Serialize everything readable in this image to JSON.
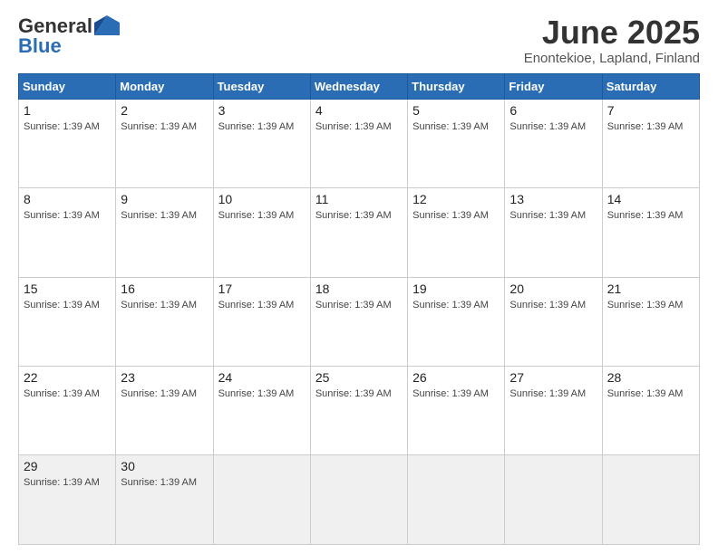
{
  "logo": {
    "general": "General",
    "blue": "Blue"
  },
  "header": {
    "month": "June 2025",
    "location": "Enontekioe, Lapland, Finland"
  },
  "days_of_week": [
    "Sunday",
    "Monday",
    "Tuesday",
    "Wednesday",
    "Thursday",
    "Friday",
    "Saturday"
  ],
  "sunrise_text": "Sunrise: 1:39 AM",
  "weeks": [
    [
      {
        "day": "1",
        "sunrise": "Sunrise: 1:39 AM"
      },
      {
        "day": "2",
        "sunrise": "Sunrise: 1:39 AM"
      },
      {
        "day": "3",
        "sunrise": "Sunrise: 1:39 AM"
      },
      {
        "day": "4",
        "sunrise": "Sunrise: 1:39 AM"
      },
      {
        "day": "5",
        "sunrise": "Sunrise: 1:39 AM"
      },
      {
        "day": "6",
        "sunrise": "Sunrise: 1:39 AM"
      },
      {
        "day": "7",
        "sunrise": "Sunrise: 1:39 AM"
      }
    ],
    [
      {
        "day": "8",
        "sunrise": "Sunrise: 1:39 AM"
      },
      {
        "day": "9",
        "sunrise": "Sunrise: 1:39 AM"
      },
      {
        "day": "10",
        "sunrise": "Sunrise: 1:39 AM"
      },
      {
        "day": "11",
        "sunrise": "Sunrise: 1:39 AM"
      },
      {
        "day": "12",
        "sunrise": "Sunrise: 1:39 AM"
      },
      {
        "day": "13",
        "sunrise": "Sunrise: 1:39 AM"
      },
      {
        "day": "14",
        "sunrise": "Sunrise: 1:39 AM"
      }
    ],
    [
      {
        "day": "15",
        "sunrise": "Sunrise: 1:39 AM"
      },
      {
        "day": "16",
        "sunrise": "Sunrise: 1:39 AM"
      },
      {
        "day": "17",
        "sunrise": "Sunrise: 1:39 AM"
      },
      {
        "day": "18",
        "sunrise": "Sunrise: 1:39 AM"
      },
      {
        "day": "19",
        "sunrise": "Sunrise: 1:39 AM"
      },
      {
        "day": "20",
        "sunrise": "Sunrise: 1:39 AM"
      },
      {
        "day": "21",
        "sunrise": "Sunrise: 1:39 AM"
      }
    ],
    [
      {
        "day": "22",
        "sunrise": "Sunrise: 1:39 AM"
      },
      {
        "day": "23",
        "sunrise": "Sunrise: 1:39 AM"
      },
      {
        "day": "24",
        "sunrise": "Sunrise: 1:39 AM"
      },
      {
        "day": "25",
        "sunrise": "Sunrise: 1:39 AM"
      },
      {
        "day": "26",
        "sunrise": "Sunrise: 1:39 AM"
      },
      {
        "day": "27",
        "sunrise": "Sunrise: 1:39 AM"
      },
      {
        "day": "28",
        "sunrise": "Sunrise: 1:39 AM"
      }
    ],
    [
      {
        "day": "29",
        "sunrise": "Sunrise: 1:39 AM"
      },
      {
        "day": "30",
        "sunrise": "Sunrise: 1:39 AM"
      },
      null,
      null,
      null,
      null,
      null
    ]
  ]
}
